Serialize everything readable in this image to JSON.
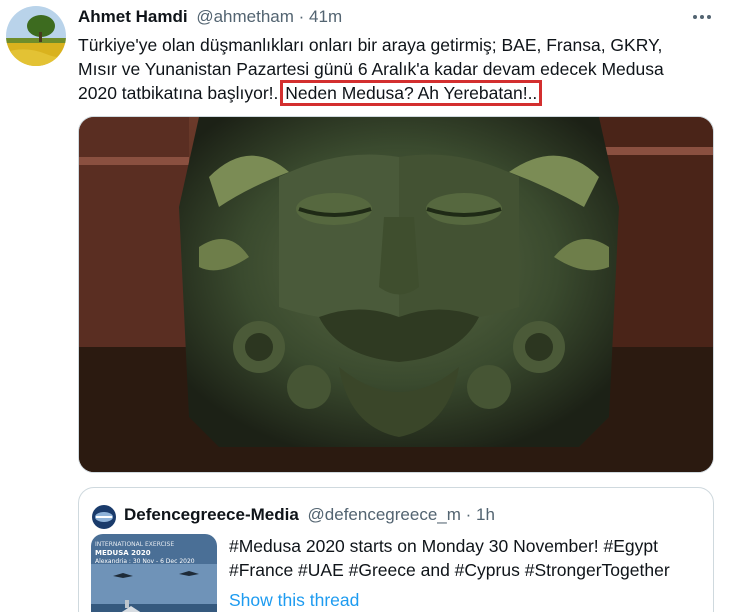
{
  "tweet": {
    "author_name": "Ahmet Hamdi",
    "author_handle": "@ahmetham",
    "separator": "·",
    "time": "41m",
    "text_lines": [
      "Türkiye'ye olan düşmanlıkları onları bir araya getirmiş; BAE, Fransa, GKRY,",
      "Mısır ve Yunanistan Pazartesi günü 6 Aralık'a kadar devam edecek Medusa",
      "2020 tatbikatına başlıyor!.."
    ],
    "highlighted_text": "Neden Medusa? Ah Yerebatan!..",
    "highlight_color": "#d32f2f",
    "media_description_icon": "medusa-head-image"
  },
  "quoted_tweet": {
    "author_name": "Defencegreece-Media",
    "author_handle": "@defencegreece_m",
    "separator": "·",
    "time": "1h",
    "thumbnail_lines": [
      "INTERNATIONAL EXERCISE",
      "MEDUSA 2020",
      "Alexandria : 30 Nov - 6 Dec 2020"
    ],
    "text_lines": [
      "#Medusa 2020 starts on Monday 30 November! #Egypt",
      "#France #UAE #Greece and #Cyprus #StrongerTogether"
    ],
    "show_thread": "Show this thread"
  },
  "colors": {
    "link": "#1d9bf0",
    "secondary_text": "#536471",
    "border": "#cfd9de"
  }
}
